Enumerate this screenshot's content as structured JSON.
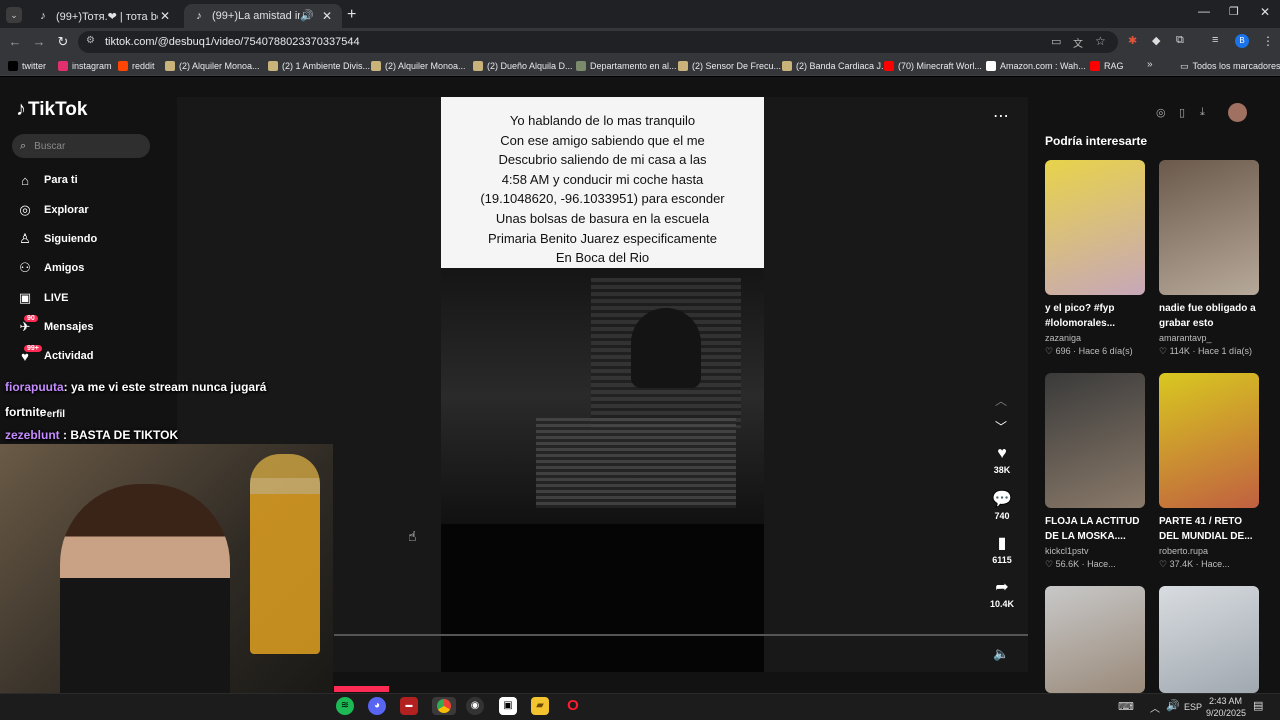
{
  "browser": {
    "tabs": [
      {
        "title": "(99+)Toтя.❤ | тота bob espon",
        "active": false
      },
      {
        "title": "(99+)La amistad inquebranta",
        "active": true
      }
    ],
    "url": "tiktok.com/@desbuq1/video/7540788023370337544",
    "bookmarks": [
      {
        "label": "twitter",
        "color": "#000000"
      },
      {
        "label": "instagram",
        "color": "#e1306c"
      },
      {
        "label": "reddit",
        "color": "#ff4500"
      },
      {
        "label": "(2) Alquiler Monoa...",
        "color": "#c9b37a"
      },
      {
        "label": "(2) 1 Ambiente Divis...",
        "color": "#c9b37a"
      },
      {
        "label": "(2) Alquiler Monoa...",
        "color": "#c9b37a"
      },
      {
        "label": "(2) Dueño Alquila D...",
        "color": "#c9b37a"
      },
      {
        "label": "Departamento en al...",
        "color": "#7a8a6a"
      },
      {
        "label": "(2) Sensor De Frecu...",
        "color": "#c9b37a"
      },
      {
        "label": "(2) Banda Cardiaca J...",
        "color": "#c9b37a"
      },
      {
        "label": "(70) Minecraft Worl...",
        "color": "#ff0000"
      },
      {
        "label": "Amazon.com : Wah...",
        "color": "#ffffff"
      },
      {
        "label": "RAG",
        "color": "#ff0000"
      }
    ],
    "all_bookmarks": "Todos los marcadores"
  },
  "tiktok": {
    "logo": "TikTok",
    "search_placeholder": "Buscar",
    "nav": [
      {
        "label": "Para ti",
        "icon": "home-icon",
        "badge": ""
      },
      {
        "label": "Explorar",
        "icon": "compass-icon",
        "badge": ""
      },
      {
        "label": "Siguiendo",
        "icon": "following-icon",
        "badge": ""
      },
      {
        "label": "Amigos",
        "icon": "friends-icon",
        "badge": ""
      },
      {
        "label": "LIVE",
        "icon": "live-icon",
        "badge": ""
      },
      {
        "label": "Mensajes",
        "icon": "messages-icon",
        "badge": "90"
      },
      {
        "label": "Actividad",
        "icon": "activity-icon",
        "badge": "99+"
      }
    ],
    "perfil": "Perfil",
    "caption": [
      "Yo hablando de lo mas tranquilo",
      "Con ese amigo sabiendo que el me",
      "Descubrio saliendo de mi casa a las",
      "4:58 AM y conducir mi coche hasta",
      "(19.1048620, -96.1033951) para esconder",
      "Unas bolsas de basura en la escuela",
      "Primaria Benito Juarez especificamente",
      "En Boca del Rio"
    ],
    "actions": [
      {
        "icon": "heart-icon",
        "count": "38K"
      },
      {
        "icon": "comment-icon",
        "count": "740"
      },
      {
        "icon": "bookmark-icon",
        "count": "6115"
      },
      {
        "icon": "share-icon",
        "count": "10.4K"
      }
    ],
    "reco_title": "Podría interesarte",
    "reco": [
      {
        "title": "y el pico? #fyp #lolomorales...",
        "author": "zazaniga",
        "likes": "696",
        "when": "Hace 6 día(s)",
        "color1": "#e8d34a",
        "color2": "#c7a7b9"
      },
      {
        "title": "nadie fue obligado a grabar esto",
        "author": "amarantavp_",
        "likes": "114K",
        "when": "Hace 1 día(s)",
        "color1": "#6b5a4c",
        "color2": "#b7a99a"
      },
      {
        "title": "FLOJA LA ACTITUD DE LA MOSKA....",
        "author": "kickcl1pstv",
        "likes": "56.6K",
        "when": "Hace...",
        "color1": "#3a3a3a",
        "color2": "#8a7a6a"
      },
      {
        "title": "PARTE 41 / RETO DEL MUNDIAL DE...",
        "author": "roberto.rupa",
        "likes": "37.4K",
        "when": "Hace...",
        "color1": "#d8c820",
        "color2": "#c06040"
      },
      {
        "title": "",
        "author": "",
        "likes": "",
        "when": "",
        "color1": "#c8c8c8",
        "color2": "#9a8a7a"
      },
      {
        "title": "",
        "author": "",
        "likes": "",
        "when": "",
        "color1": "#d8dce0",
        "color2": "#a0a8b0"
      }
    ]
  },
  "chat": [
    {
      "user": "fiorapuuta",
      "message": ": ya me vi este stream nunca jugará",
      "user_color": "#c58cff"
    },
    {
      "user": "",
      "message": "fortnite",
      "user_color": "#ffffff"
    },
    {
      "user": "zezeblunt",
      "message": " : BASTA DE TIKTOK ",
      "user_color": "#c58cff"
    }
  ],
  "taskbar": {
    "time": "2:43 AM",
    "date": "9/20/2025",
    "lang": "ESP"
  }
}
